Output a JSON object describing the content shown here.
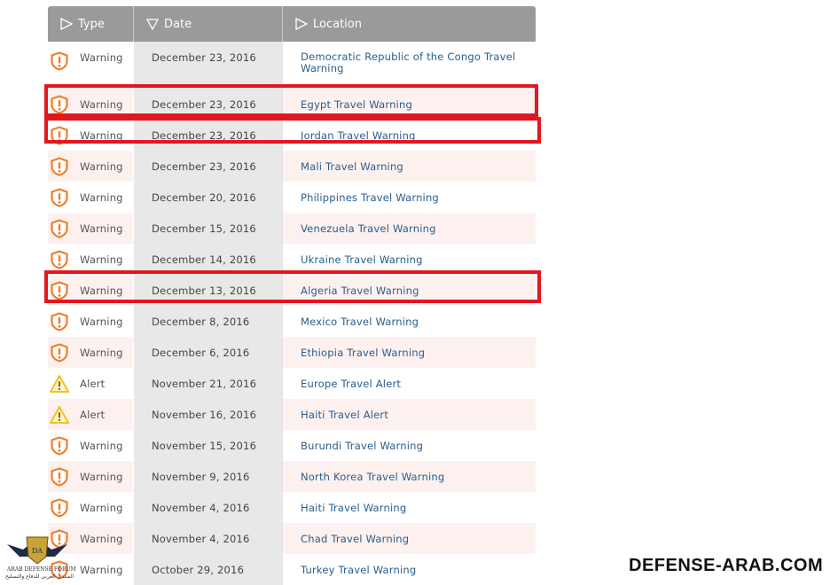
{
  "header": {
    "type": "Type",
    "date": "Date",
    "location": "Location"
  },
  "rows": [
    {
      "type": "Warning",
      "date": "December 23, 2016",
      "location": "Democratic Republic of the Congo Travel Warning",
      "icon": "shield-warning-icon"
    },
    {
      "type": "Warning",
      "date": "December 23, 2016",
      "location": "Egypt Travel Warning",
      "icon": "shield-warning-icon"
    },
    {
      "type": "Warning",
      "date": "December 23, 2016",
      "location": "Jordan Travel Warning",
      "icon": "shield-warning-icon"
    },
    {
      "type": "Warning",
      "date": "December 23, 2016",
      "location": "Mali Travel Warning",
      "icon": "shield-warning-icon"
    },
    {
      "type": "Warning",
      "date": "December 20, 2016",
      "location": "Philippines Travel Warning",
      "icon": "shield-warning-icon"
    },
    {
      "type": "Warning",
      "date": "December 15, 2016",
      "location": "Venezuela Travel Warning",
      "icon": "shield-warning-icon"
    },
    {
      "type": "Warning",
      "date": "December 14, 2016",
      "location": "Ukraine Travel Warning",
      "icon": "shield-warning-icon"
    },
    {
      "type": "Warning",
      "date": "December 13, 2016",
      "location": "Algeria Travel Warning",
      "icon": "shield-warning-icon"
    },
    {
      "type": "Warning",
      "date": "December 8, 2016",
      "location": "Mexico Travel Warning",
      "icon": "shield-warning-icon"
    },
    {
      "type": "Warning",
      "date": "December 6, 2016",
      "location": "Ethiopia Travel Warning",
      "icon": "shield-warning-icon"
    },
    {
      "type": "Alert",
      "date": "November 21, 2016",
      "location": "Europe Travel Alert",
      "icon": "triangle-alert-icon"
    },
    {
      "type": "Alert",
      "date": "November 16, 2016",
      "location": "Haiti Travel Alert",
      "icon": "triangle-alert-icon"
    },
    {
      "type": "Warning",
      "date": "November 15, 2016",
      "location": "Burundi Travel Warning",
      "icon": "shield-warning-icon"
    },
    {
      "type": "Warning",
      "date": "November 9, 2016",
      "location": "North Korea Travel Warning",
      "icon": "shield-warning-icon"
    },
    {
      "type": "Warning",
      "date": "November 4, 2016",
      "location": "Haiti Travel Warning",
      "icon": "shield-warning-icon"
    },
    {
      "type": "Warning",
      "date": "November 4, 2016",
      "location": "Chad Travel Warning",
      "icon": "shield-warning-icon"
    },
    {
      "type": "Warning",
      "date": "October 29, 2016",
      "location": "Turkey Travel Warning",
      "icon": "shield-warning-icon"
    }
  ],
  "colors": {
    "highlight": "#e3161f",
    "warning": "#f07d2a",
    "alert": "#f3c220",
    "link": "#2a5d8c",
    "header": "#9a9a9a"
  },
  "watermark": {
    "site": "DEFENSE-ARAB.COM",
    "logo_line1": "ARAB DEFENSE FORUM",
    "logo_line2": "المنتدى العربي للدفاع والتسليح"
  }
}
